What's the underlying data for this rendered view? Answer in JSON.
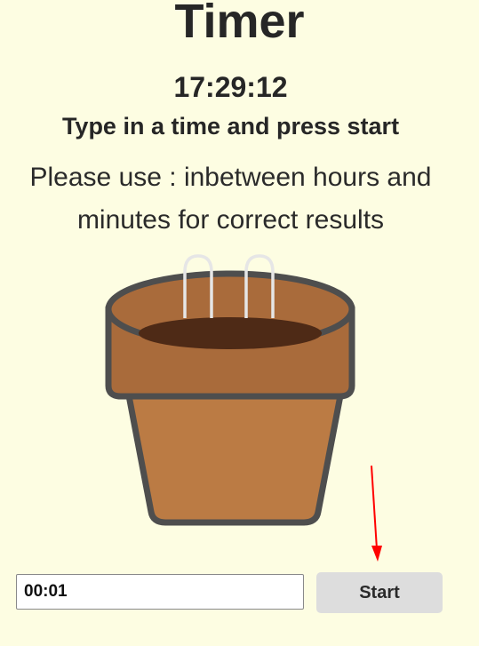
{
  "page": {
    "title": "Timer",
    "clock": "17:29:12",
    "instruction": "Type in a time and press start",
    "note": "Please use : inbetween hours and minutes for correct results"
  },
  "illustration": {
    "icon": "flower-pot-icon",
    "colors": {
      "outline": "#4e4e4e",
      "body": "#bb7b44",
      "rim": "#a96b3b",
      "soil": "#4e2a16",
      "wire": "#e6e6e6",
      "background": "#fdfde2"
    }
  },
  "controls": {
    "time_value": "00:01",
    "start_label": "Start"
  },
  "annotation": {
    "icon": "red-arrow-icon",
    "color": "#ff0000"
  }
}
